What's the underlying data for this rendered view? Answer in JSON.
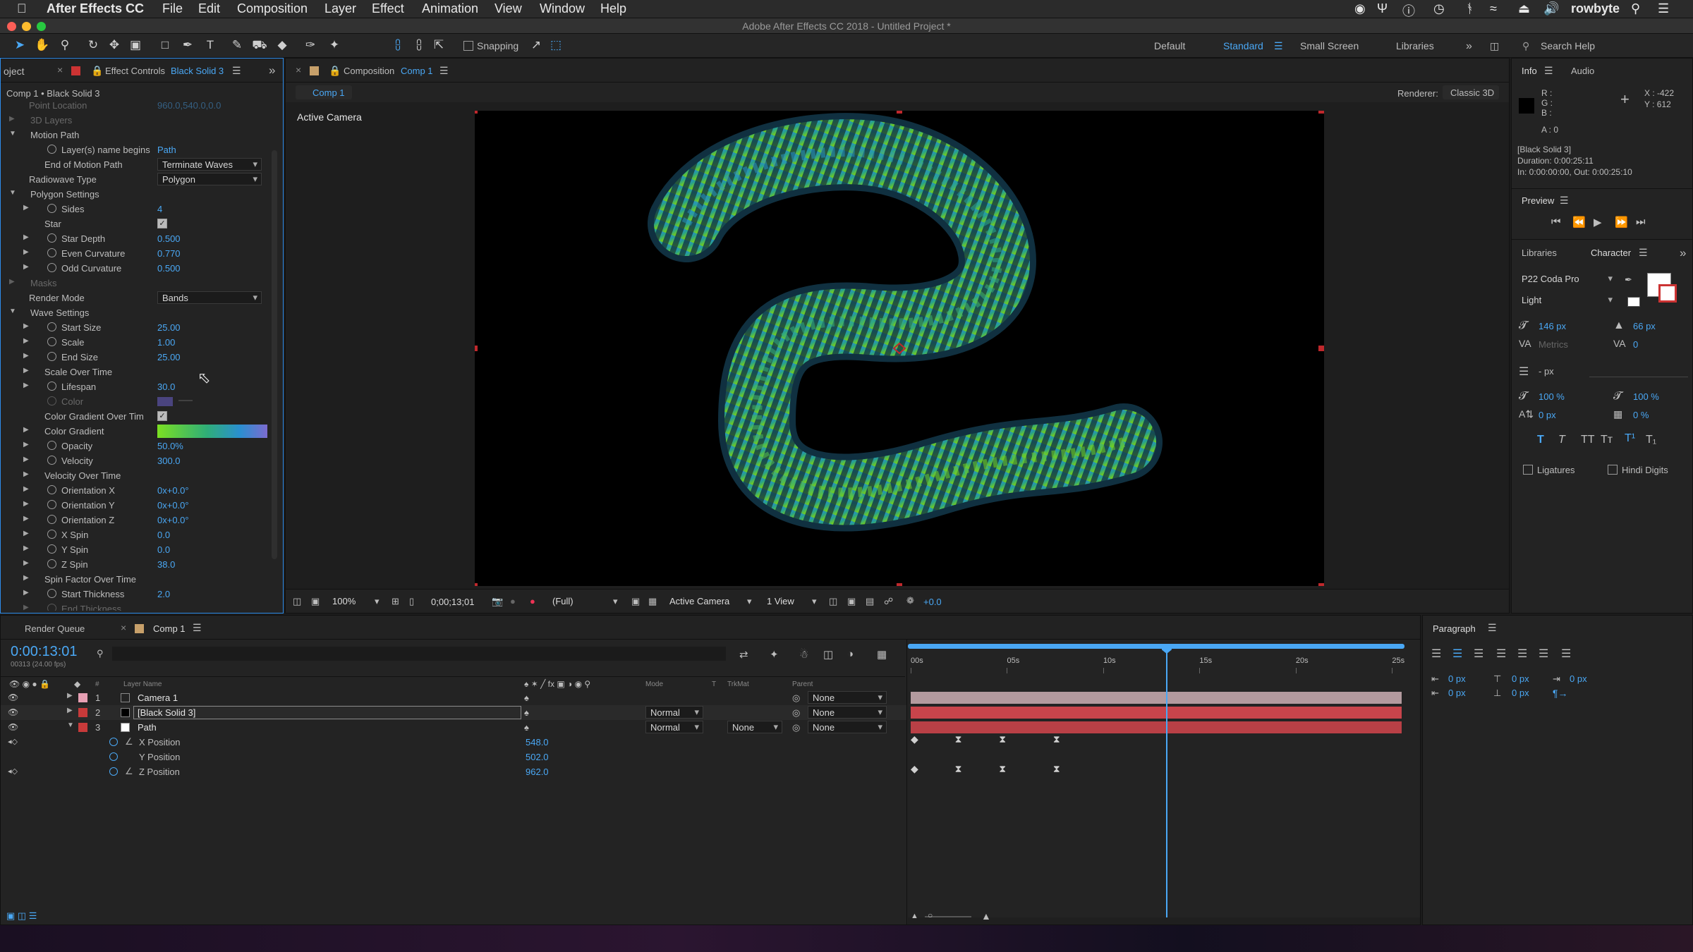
{
  "menubar": {
    "app": "After Effects CC",
    "items": [
      "File",
      "Edit",
      "Composition",
      "Layer",
      "Effect",
      "Animation",
      "View",
      "Window",
      "Help"
    ],
    "user": "rowbyte"
  },
  "window_title": "Adobe After Effects CC 2018 - Untitled Project *",
  "toolbar": {
    "snapping": "Snapping",
    "workspaces": [
      "Default",
      "Standard",
      "Small Screen",
      "Libraries"
    ],
    "search_placeholder": "Search Help"
  },
  "left_panel": {
    "tab_project": "oject",
    "tab_effect": "Effect Controls",
    "tab_effect_layer": "Black Solid 3",
    "subtitle": "Comp 1 • Black Solid 3",
    "rows": [
      {
        "ind": 0,
        "lbl": "Point Location",
        "val": "960.0,540.0,0.0",
        "faded": true
      },
      {
        "ind": 0,
        "tri": "r",
        "lbl": "3D Layers",
        "faded": true
      },
      {
        "ind": 0,
        "tri": "d",
        "lbl": "Motion Path"
      },
      {
        "ind": 1,
        "sw": true,
        "lbl": "Layer(s) name begins",
        "val": "Path"
      },
      {
        "ind": 1,
        "lbl": "End of Motion Path",
        "dd": "Terminate Waves"
      },
      {
        "ind": 0,
        "lbl": "Radiowave Type",
        "dd": "Polygon"
      },
      {
        "ind": 0,
        "tri": "d",
        "lbl": "Polygon Settings"
      },
      {
        "ind": 1,
        "tri": "r",
        "sw": true,
        "lbl": "Sides",
        "val": "4"
      },
      {
        "ind": 1,
        "lbl": "Star",
        "chk": true
      },
      {
        "ind": 1,
        "tri": "r",
        "sw": true,
        "lbl": "Star Depth",
        "val": "0.500"
      },
      {
        "ind": 1,
        "tri": "r",
        "sw": true,
        "lbl": "Even Curvature",
        "val": "0.770"
      },
      {
        "ind": 1,
        "tri": "r",
        "sw": true,
        "lbl": "Odd Curvature",
        "val": "0.500"
      },
      {
        "ind": 0,
        "tri": "r",
        "lbl": "Masks",
        "faded": true
      },
      {
        "ind": 0,
        "lbl": "Render Mode",
        "dd": "Bands"
      },
      {
        "ind": 0,
        "tri": "d",
        "lbl": "Wave Settings"
      },
      {
        "ind": 1,
        "tri": "r",
        "sw": true,
        "lbl": "Start Size",
        "val": "25.00"
      },
      {
        "ind": 1,
        "tri": "r",
        "sw": true,
        "lbl": "Scale",
        "val": "1.00"
      },
      {
        "ind": 1,
        "tri": "r",
        "sw": true,
        "lbl": "End Size",
        "val": "25.00"
      },
      {
        "ind": 1,
        "tri": "r",
        "lbl": "Scale Over Time"
      },
      {
        "ind": 1,
        "tri": "r",
        "sw": true,
        "lbl": "Lifespan",
        "val": "30.0"
      },
      {
        "ind": 1,
        "sw": true,
        "lbl": "Color",
        "swatch": true,
        "faded": true
      },
      {
        "ind": 1,
        "lbl": "Color Gradient Over Tim",
        "chk": true
      },
      {
        "ind": 1,
        "tri": "r",
        "lbl": "Color Gradient",
        "grad": true
      },
      {
        "ind": 1,
        "tri": "r",
        "sw": true,
        "lbl": "Opacity",
        "val": "50.0%"
      },
      {
        "ind": 1,
        "tri": "r",
        "sw": true,
        "lbl": "Velocity",
        "val": "300.0"
      },
      {
        "ind": 1,
        "tri": "r",
        "lbl": "Velocity Over Time"
      },
      {
        "ind": 1,
        "tri": "r",
        "sw": true,
        "lbl": "Orientation X",
        "val": "0x+0.0°"
      },
      {
        "ind": 1,
        "tri": "r",
        "sw": true,
        "lbl": "Orientation Y",
        "val": "0x+0.0°"
      },
      {
        "ind": 1,
        "tri": "r",
        "sw": true,
        "lbl": "Orientation Z",
        "val": "0x+0.0°"
      },
      {
        "ind": 1,
        "tri": "r",
        "sw": true,
        "lbl": "X Spin",
        "val": "0.0"
      },
      {
        "ind": 1,
        "tri": "r",
        "sw": true,
        "lbl": "Y Spin",
        "val": "0.0"
      },
      {
        "ind": 1,
        "tri": "r",
        "sw": true,
        "lbl": "Z Spin",
        "val": "38.0"
      },
      {
        "ind": 1,
        "tri": "r",
        "lbl": "Spin Factor Over Time"
      },
      {
        "ind": 1,
        "tri": "r",
        "sw": true,
        "lbl": "Start Thickness",
        "val": "2.0"
      },
      {
        "ind": 1,
        "tri": "r",
        "sw": true,
        "lbl": "End Thickness",
        "val": "",
        "faded": true
      }
    ]
  },
  "comp_panel": {
    "tab_prefix": "Composition",
    "tab_comp": "Comp 1",
    "subtab": "Comp 1",
    "renderer_label": "Renderer:",
    "renderer": "Classic 3D",
    "view_label": "Active Camera",
    "footer": {
      "zoom": "100%",
      "timecode": "0;00;13;01",
      "resolution": "(Full)",
      "camera": "Active Camera",
      "views": "1 View",
      "exposure": "+0.0"
    }
  },
  "info_panel": {
    "tabs": [
      "Info",
      "Audio"
    ],
    "rgba": [
      "R :",
      "G :",
      "B :",
      "A : 0"
    ],
    "x": "X : -422",
    "y": "Y : 612",
    "layer": "[Black Solid 3]",
    "duration": "Duration: 0:00:25:11",
    "inout": "In: 0:00:00:00, Out: 0:00:25:10"
  },
  "preview_panel": {
    "title": "Preview"
  },
  "character_panel": {
    "tabs": [
      "Libraries",
      "Character"
    ],
    "font": "P22 Coda Pro",
    "style": "Light",
    "size": "146 px",
    "leading": "66 px",
    "kerning": "Metrics",
    "tracking": "0",
    "stroke": "- px",
    "vscale": "100 %",
    "hscale": "100 %",
    "baseline": "0 px",
    "tsume": "0 %",
    "ligatures": "Ligatures",
    "hindi": "Hindi Digits"
  },
  "timeline": {
    "tabs": [
      "Render Queue",
      "Comp 1"
    ],
    "timecode": "0:00:13:01",
    "fps": "00313 (24.00 fps)",
    "cols": [
      "#",
      "Layer Name",
      "Mode",
      "T",
      "TrkMat",
      "Parent"
    ],
    "ticks": [
      "00s",
      "05s",
      "10s",
      "15s",
      "20s",
      "25s"
    ],
    "current_fraction": 0.52,
    "layers": [
      {
        "num": "1",
        "name": "Camera 1",
        "color": "#e7a0b4",
        "mode": "",
        "trk": "",
        "parent": "None",
        "bar": "#b39a9e"
      },
      {
        "num": "2",
        "name": "[Black Solid 3]",
        "color": "#c83a3a",
        "mode": "Normal",
        "trk": "",
        "parent": "None",
        "bar": "#c9444b"
      },
      {
        "num": "3",
        "name": "Path",
        "color": "#c83a3a",
        "mode": "Normal",
        "trk": "None",
        "parent": "None",
        "bar": "#b94046"
      }
    ],
    "props": [
      {
        "name": "X Position",
        "val": "548.0"
      },
      {
        "name": "Y Position",
        "val": "502.0"
      },
      {
        "name": "Z Position",
        "val": "962.0"
      }
    ]
  },
  "paragraph_panel": {
    "title": "Paragraph",
    "fields": [
      "0 px",
      "0 px",
      "0 px",
      "0 px",
      "0 px"
    ]
  },
  "colors": {
    "accent": "#4aa8f5",
    "bg": "#232323",
    "selection": "#2d8ceb"
  }
}
